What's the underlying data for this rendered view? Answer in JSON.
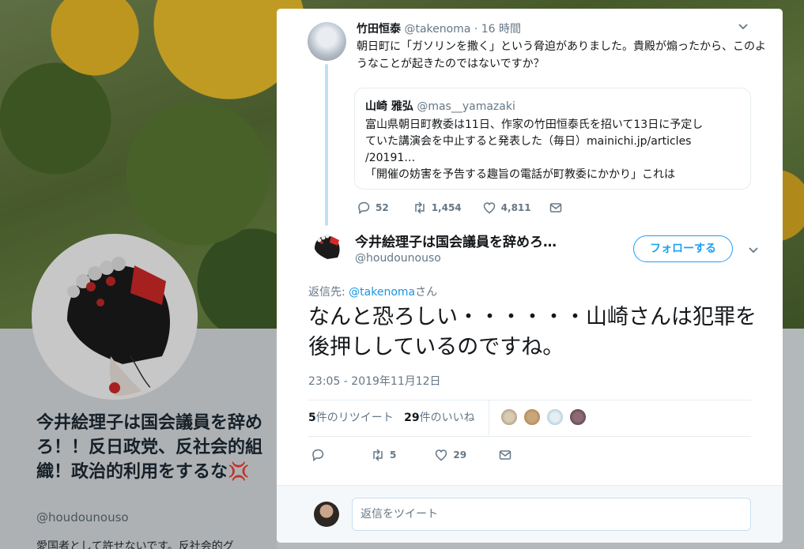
{
  "profile": {
    "name": "今井絵理子は国会議員を辞めろ！！反日政党、反社会的組織！政治的利用をするな",
    "name_emoji": "💢",
    "handle": "@houdounouso",
    "bio_partial": "愛国者として許せないです。反社会的グ"
  },
  "tweet_parent": {
    "name": "竹田恒泰",
    "handle": "@takenoma",
    "time": "· 16 時間",
    "text": "朝日町に「ガソリンを撒く」という脅迫がありました。貴殿が煽ったから、このようなことが起きたのではないですか？",
    "quote": {
      "name": "山崎 雅弘",
      "handle": "@mas__yamazaki",
      "lines": [
        "富山県朝日町教委は11日、作家の竹田恒泰氏を招いて13日に予定し",
        "ていた講演会を中止すると発表した（毎日）mainichi.jp/articles",
        "/20191…",
        "「開催の妨害を予告する趣旨の電話が町教委にかかり」これは"
      ]
    },
    "replies": "52",
    "retweets": "1,454",
    "likes": "4,811"
  },
  "tweet_main": {
    "name": "今井絵理子は国会議員を辞めろ！！反日政党、反社会的組織！政治的利用をするな",
    "handle": "@houdounouso",
    "follow_label": "フォローする",
    "reply_prefix": "返信先: ",
    "reply_to": "@takenoma",
    "reply_suffix": "さん",
    "text": "なんと恐ろしい・・・・・・山崎さんは犯罪を後押ししているのですね。",
    "timestamp": "23:05 - 2019年11月12日",
    "retweet_count": "5",
    "retweet_label": "件のリツイート",
    "like_count": "29",
    "like_label": "件のいいね",
    "action_retweets": "5",
    "action_likes": "29"
  },
  "reply_box": {
    "placeholder": "返信をツイート"
  },
  "colors": {
    "accent": "#1da1f2",
    "text": "#14171a",
    "muted": "#657786"
  }
}
